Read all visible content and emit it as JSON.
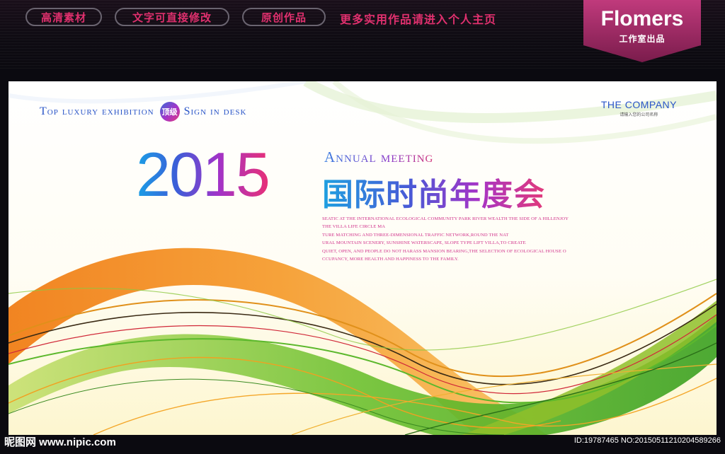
{
  "topbar": {
    "pills": [
      "高清素材",
      "文字可直接修改",
      "原创作品"
    ],
    "promo": "更多实用作品请进入个人主页",
    "brand_name": "Flomers",
    "brand_sub": "工作室出品"
  },
  "banner": {
    "tagline_part1": "Top luxury exhibition",
    "badge": "顶级",
    "tagline_part2": "Sign in desk",
    "company_name": "THE COMPANY",
    "company_sub": "请输入您的公司名称",
    "year": "2015",
    "annual": "Annual meeting",
    "cn_title": "国际时尚年度会",
    "body_lines": [
      "SEATIC AT THE INTERNATIONAL ECOLOGICAL COMMUNITY PARK RIVER WEALTH THE SIDE OF A HILLENJOY",
      "THE VILLA LIFE CIRCLE MA",
      "TURE MATCHING AND THREE-DIMENSIONAL TRAFFIC NETWORK,ROUND THE NAT",
      "URAL MOUNTAIN SCENERY, SUNSHINE WATERSCAPE, SLOPE TYPE LIFT VILLA,TO CREATE",
      "QUIET, OPEN, AND PEOPLE DO NOT HARASS MANSION BEARING,THE SELECTION OF ECOLOGICAL HOUSE O",
      "CCUPANCY, MORE HEALTH AND HAPPINESS TO THE FAMILY."
    ]
  },
  "footer": {
    "watermark": "昵图网 www.nipic.com",
    "id_text": "ID:19787465 NO:20150511210204589266"
  },
  "colors": {
    "accent_pink": "#e0306e",
    "blue": "#2a55c8",
    "orange": "#f28a1c",
    "green": "#5cb82c"
  }
}
